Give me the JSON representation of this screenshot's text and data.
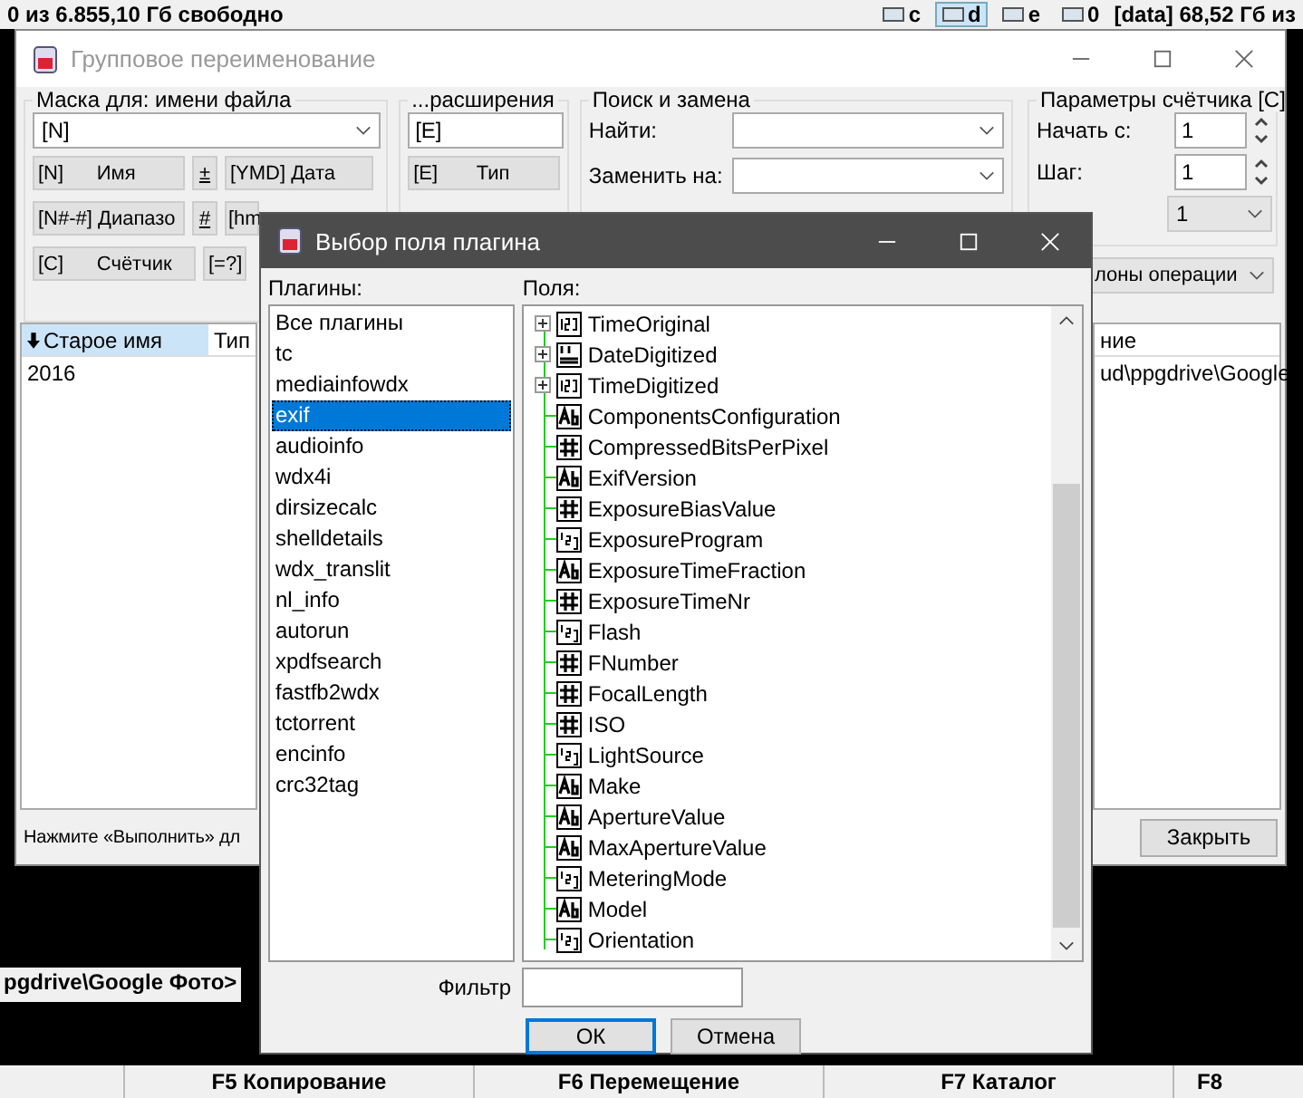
{
  "file_manager": {
    "free_space_left": "0 из 6.855,10 Гб свободно",
    "drives": [
      {
        "label": "c",
        "selected": false
      },
      {
        "label": "d",
        "selected": true
      },
      {
        "label": "e",
        "selected": false
      },
      {
        "label": "0",
        "selected": false
      }
    ],
    "free_space_right": "[data]  68,52 Гб из",
    "command_path": "pgdrive\\Google Фото>",
    "function_keys": [
      "F5 Копирование",
      "F6 Перемещение",
      "F7 Каталог",
      "F8"
    ]
  },
  "rename_dialog": {
    "title": "Групповое переименование",
    "mask_group": {
      "label": "Маска для: имени файла",
      "value": "[N]",
      "button_rows": [
        [
          "[N]      Имя",
          "±",
          "[YMD] Дата"
        ],
        [
          "[N#-#] Диапазо",
          "#",
          "[hm"
        ],
        [
          "[C]      Счётчик",
          "[=?]"
        ]
      ]
    },
    "extension_group": {
      "label": "...расширения",
      "value": "[E]",
      "button": "[E]       Тип"
    },
    "search_group": {
      "label": "Поиск и замена",
      "find_label": "Найти:",
      "replace_label": "Заменить на:"
    },
    "counter_group": {
      "label": "Параметры счётчика [C]",
      "start_label": "Начать с:",
      "start": "1",
      "step_label": "Шаг:",
      "step": "1",
      "digits": "1"
    },
    "templates": "лоны операции",
    "columns": [
      "Старое имя",
      "Тип"
    ],
    "rows": [
      "2016"
    ],
    "right_column": "ние",
    "right_row": "ud\\ppgdrive\\Google",
    "status": "Нажмите «Выполнить» дл",
    "close_button": "Закрыть"
  },
  "plugin_dialog": {
    "title": "Выбор поля плагина",
    "plugins_label": "Плагины:",
    "fields_label": "Поля:",
    "plugins": [
      {
        "name": "Все плагины",
        "selected": false
      },
      {
        "name": "tc",
        "selected": false
      },
      {
        "name": "mediainfowdx",
        "selected": false
      },
      {
        "name": "exif",
        "selected": true
      },
      {
        "name": "audioinfo",
        "selected": false
      },
      {
        "name": "wdx4i",
        "selected": false
      },
      {
        "name": "dirsizecalc",
        "selected": false
      },
      {
        "name": "shelldetails",
        "selected": false
      },
      {
        "name": "wdx_translit",
        "selected": false
      },
      {
        "name": "nl_info",
        "selected": false
      },
      {
        "name": "autorun",
        "selected": false
      },
      {
        "name": "xpdfsearch",
        "selected": false
      },
      {
        "name": "fastfb2wdx",
        "selected": false
      },
      {
        "name": "tctorrent",
        "selected": false
      },
      {
        "name": "encinfo",
        "selected": false
      },
      {
        "name": "crc32tag",
        "selected": false
      }
    ],
    "fields": [
      {
        "name": "TimeOriginal",
        "kind": "time",
        "expandable": true
      },
      {
        "name": "DateDigitized",
        "kind": "date",
        "expandable": true
      },
      {
        "name": "TimeDigitized",
        "kind": "time",
        "expandable": true
      },
      {
        "name": "ComponentsConfiguration",
        "kind": "text",
        "expandable": false
      },
      {
        "name": "CompressedBitsPerPixel",
        "kind": "number",
        "expandable": false
      },
      {
        "name": "ExifVersion",
        "kind": "text",
        "expandable": false
      },
      {
        "name": "ExposureBiasValue",
        "kind": "number",
        "expandable": false
      },
      {
        "name": "ExposureProgram",
        "kind": "enum",
        "expandable": false
      },
      {
        "name": "ExposureTimeFraction",
        "kind": "text",
        "expandable": false
      },
      {
        "name": "ExposureTimeNr",
        "kind": "number",
        "expandable": false
      },
      {
        "name": "Flash",
        "kind": "enum",
        "expandable": false
      },
      {
        "name": "FNumber",
        "kind": "number",
        "expandable": false
      },
      {
        "name": "FocalLength",
        "kind": "number",
        "expandable": false
      },
      {
        "name": "ISO",
        "kind": "number",
        "expandable": false
      },
      {
        "name": "LightSource",
        "kind": "enum",
        "expandable": false
      },
      {
        "name": "Make",
        "kind": "text",
        "expandable": false
      },
      {
        "name": "ApertureValue",
        "kind": "text",
        "expandable": false
      },
      {
        "name": "MaxApertureValue",
        "kind": "text",
        "expandable": false
      },
      {
        "name": "MeteringMode",
        "kind": "enum",
        "expandable": false
      },
      {
        "name": "Model",
        "kind": "text",
        "expandable": false
      },
      {
        "name": "Orientation",
        "kind": "enum",
        "expandable": false
      }
    ],
    "filter_label": "Фильтр",
    "ok_button": "ОК",
    "cancel_button": "Отмена"
  }
}
